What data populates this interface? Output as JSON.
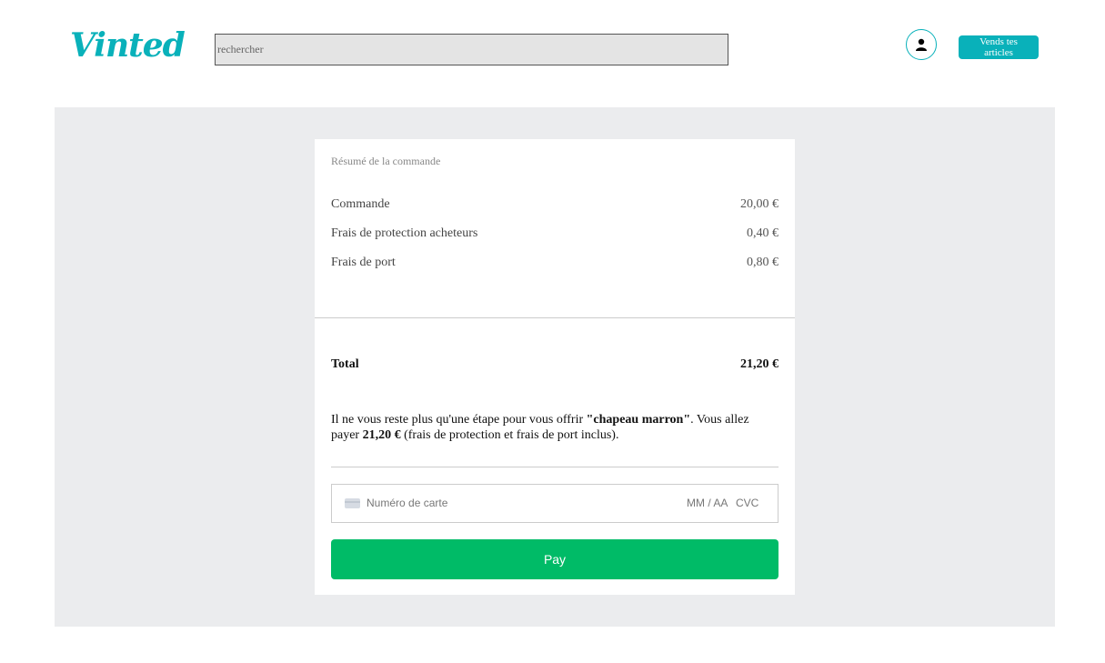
{
  "header": {
    "logo_text": "Vinted",
    "search_placeholder": "rechercher",
    "sell_button_label": "Vends tes articles",
    "accent_color": "#09b1ba"
  },
  "summary": {
    "title": "Résumé de la commande",
    "lines": [
      {
        "label": "Commande",
        "amount": "20,00 €"
      },
      {
        "label": "Frais de protection acheteurs",
        "amount": "0,40 €"
      },
      {
        "label": "Frais de port",
        "amount": "0,80 €"
      }
    ],
    "total_label": "Total",
    "total_amount": "21,20 €"
  },
  "message": {
    "part1": "Il ne vous reste plus qu'une étape pour vous offrir ",
    "item_name": "\"chapeau marron\"",
    "part2": ". Vous allez payer ",
    "amount": "21,20 €",
    "part3": " (frais de protection et frais de port inclus)."
  },
  "payment": {
    "card_number_placeholder": "Numéro de carte",
    "expiry_placeholder": "MM / AA",
    "cvc_placeholder": "CVC",
    "pay_button_label": "Pay",
    "pay_color": "#00bb67"
  }
}
